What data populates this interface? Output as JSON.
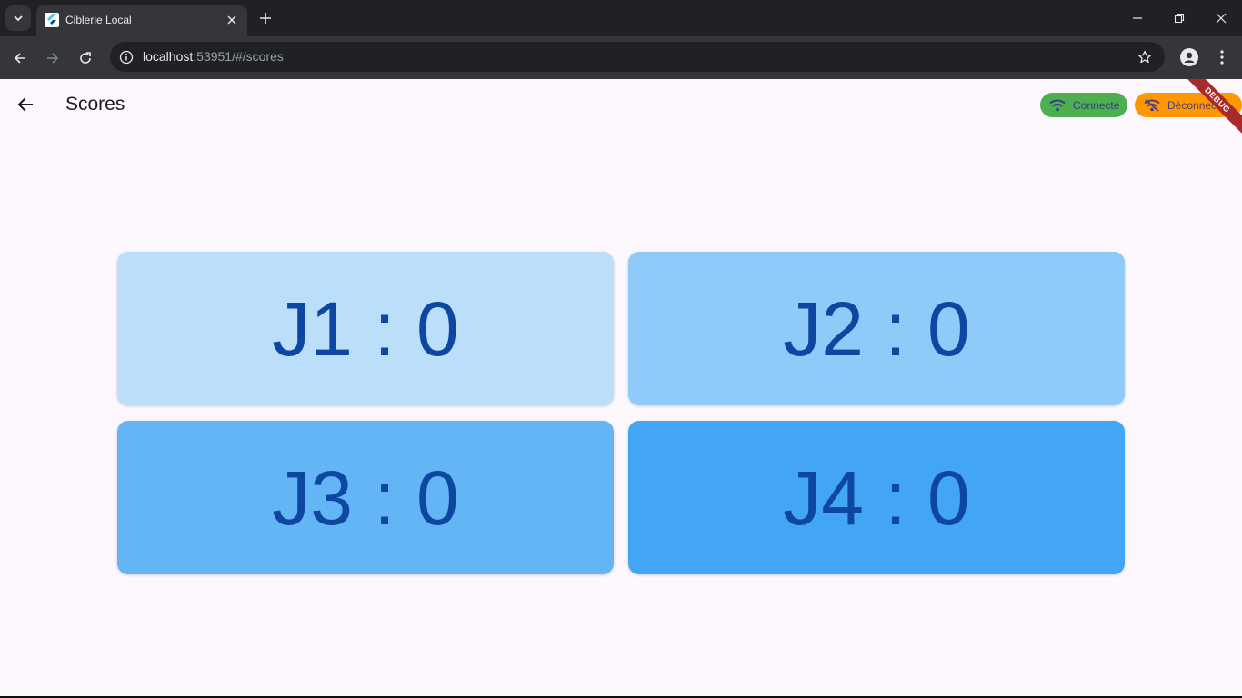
{
  "browser": {
    "tab_title": "Ciblerie Local",
    "url_host": "localhost",
    "url_rest": ":53951/#/scores"
  },
  "app": {
    "title": "Scores",
    "status_connected": "Connecté",
    "status_disconnected": "Déconnecté",
    "debug_label": "DEBUG"
  },
  "scores": [
    {
      "label": "J1 : 0",
      "color": "#bbdefb"
    },
    {
      "label": "J2 : 0",
      "color": "#90caf9"
    },
    {
      "label": "J3 : 0",
      "color": "#64b5f6"
    },
    {
      "label": "J4 : 0",
      "color": "#42a5f5"
    }
  ],
  "colors": {
    "score_text": "#0d47a1",
    "connected": "#4caf50",
    "disconnected": "#ff9800"
  }
}
